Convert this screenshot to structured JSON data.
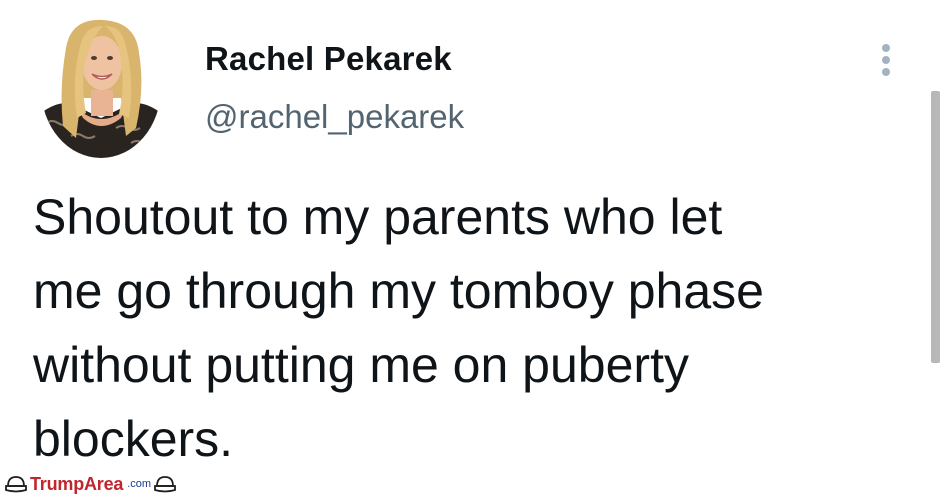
{
  "tweet": {
    "author_name": "Rachel Pekarek",
    "author_handle": "@rachel_pekarek",
    "text_lines": [
      "Shoutout to my parents who let",
      "me go through my tomboy phase",
      "without putting me on puberty",
      "blockers."
    ]
  },
  "icons": {
    "avatar": "profile-photo",
    "more": "more-vertical-icon"
  },
  "watermark": {
    "brand": "TrumpArea",
    "domain": ".com"
  },
  "colors": {
    "text_primary": "#0f1419",
    "text_secondary": "#536471",
    "more_icon": "#a3b3c1",
    "watermark_red": "#c0262d",
    "watermark_blue": "#1e3a8a"
  }
}
